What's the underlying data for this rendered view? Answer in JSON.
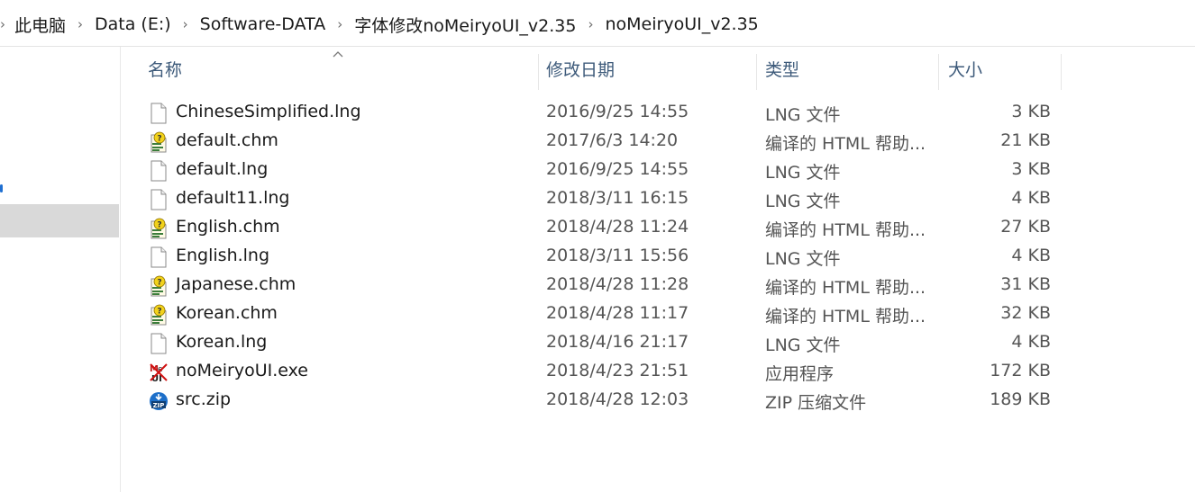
{
  "breadcrumb": [
    "此电脑",
    "Data (E:)",
    "Software-DATA",
    "字体修改noMeiryoUI_v2.35",
    "noMeiryoUI_v2.35"
  ],
  "columns": {
    "name": "名称",
    "date": "修改日期",
    "type": "类型",
    "size": "大小"
  },
  "files": [
    {
      "name": "ChineseSimplified.lng",
      "date": "2016/9/25 14:55",
      "type": "LNG 文件",
      "size": "3 KB",
      "icon": "file-icon"
    },
    {
      "name": "default.chm",
      "date": "2017/6/3 14:20",
      "type": "编译的 HTML 帮助...",
      "size": "21 KB",
      "icon": "help-file-icon"
    },
    {
      "name": "default.lng",
      "date": "2016/9/25 14:55",
      "type": "LNG 文件",
      "size": "3 KB",
      "icon": "file-icon"
    },
    {
      "name": "default11.lng",
      "date": "2018/3/11 16:15",
      "type": "LNG 文件",
      "size": "4 KB",
      "icon": "file-icon"
    },
    {
      "name": "English.chm",
      "date": "2018/4/28 11:24",
      "type": "编译的 HTML 帮助...",
      "size": "27 KB",
      "icon": "help-file-icon"
    },
    {
      "name": "English.lng",
      "date": "2018/3/11 15:56",
      "type": "LNG 文件",
      "size": "4 KB",
      "icon": "file-icon"
    },
    {
      "name": "Japanese.chm",
      "date": "2018/4/28 11:28",
      "type": "编译的 HTML 帮助...",
      "size": "31 KB",
      "icon": "help-file-icon"
    },
    {
      "name": "Korean.chm",
      "date": "2018/4/28 11:17",
      "type": "编译的 HTML 帮助...",
      "size": "32 KB",
      "icon": "help-file-icon"
    },
    {
      "name": "Korean.lng",
      "date": "2018/4/16 21:17",
      "type": "LNG 文件",
      "size": "4 KB",
      "icon": "file-icon"
    },
    {
      "name": "noMeiryoUI.exe",
      "date": "2018/4/23 21:51",
      "type": "应用程序",
      "size": "172 KB",
      "icon": "app-exe-icon"
    },
    {
      "name": "src.zip",
      "date": "2018/4/28 12:03",
      "type": "ZIP 压缩文件",
      "size": "189 KB",
      "icon": "zip-file-icon"
    }
  ]
}
